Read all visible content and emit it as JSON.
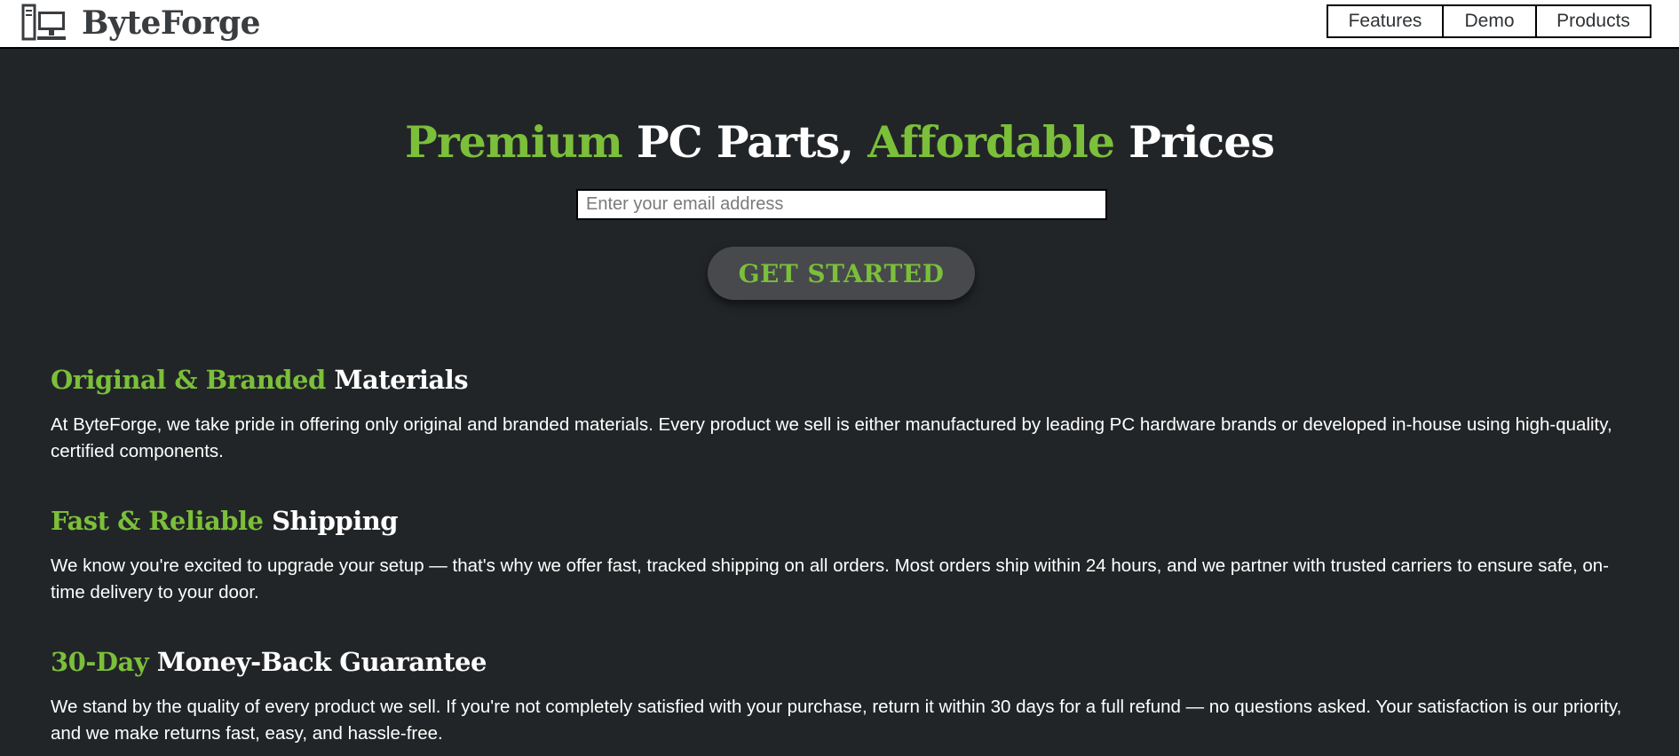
{
  "brand": {
    "name": "ByteForge",
    "logo_icon": "desktop-computer-icon"
  },
  "nav": {
    "items": [
      {
        "label": "Features"
      },
      {
        "label": "Demo"
      },
      {
        "label": "Products"
      }
    ]
  },
  "hero": {
    "title_parts": [
      "Premium",
      " PC Parts, ",
      "Affordable",
      " Prices"
    ],
    "email_placeholder": "Enter your email address",
    "cta_label": "GET STARTED"
  },
  "features": [
    {
      "title_highlight": "Original & Branded",
      "title_rest": " Materials",
      "text": "At ByteForge, we take pride in offering only original and branded materials. Every product we sell is either manufactured by leading PC hardware brands or developed in-house using high-quality, certified components."
    },
    {
      "title_highlight": "Fast & Reliable",
      "title_rest": " Shipping",
      "text": "We know you're excited to upgrade your setup — that's why we offer fast, tracked shipping on all orders. Most orders ship within 24 hours, and we partner with trusted carriers to ensure safe, on-time delivery to your door."
    },
    {
      "title_highlight": "30-Day",
      "title_rest": " Money-Back Guarantee",
      "text": "We stand by the quality of every product we sell. If you're not completely satisfied with your purchase, return it within 30 days for a full refund — no questions asked. Your satisfaction is our priority, and we make returns fast, easy, and hassle-free."
    }
  ],
  "colors": {
    "background": "#222527",
    "accent_green": "#7bbf3a",
    "button_bg": "#47494c",
    "header_bg": "#ffffff"
  }
}
